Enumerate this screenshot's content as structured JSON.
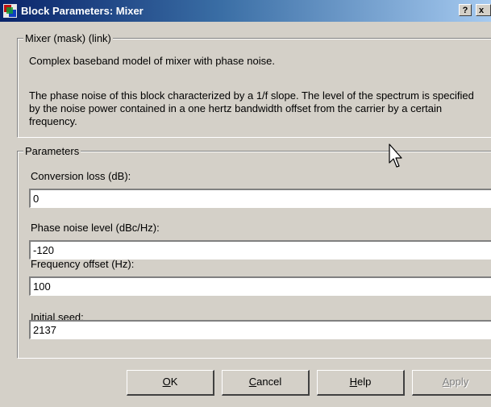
{
  "window": {
    "title": "Block Parameters: Mixer",
    "help_glyph": "?",
    "close_glyph": "x"
  },
  "mask": {
    "legend": "Mixer (mask) (link)",
    "summary": "Complex baseband model of mixer with phase noise.",
    "description": "The phase noise of this block characterized by a 1/f slope.  The level of the spectrum is specified by the noise power contained in a one hertz bandwidth offset from the carrier by a certain frequency."
  },
  "parameters": {
    "legend": "Parameters",
    "fields": [
      {
        "label": "Conversion loss (dB):",
        "value": "0"
      },
      {
        "label": "Phase noise level (dBc/Hz):",
        "value": "-120"
      },
      {
        "label": "Frequency offset (Hz):",
        "value": "100"
      },
      {
        "label": "Initial seed:",
        "value": "2137"
      }
    ]
  },
  "buttons": {
    "ok": {
      "mnemonic": "O",
      "rest": "K"
    },
    "cancel": {
      "mnemonic": "C",
      "rest": "ancel"
    },
    "help": {
      "mnemonic": "H",
      "rest": "elp"
    },
    "apply": {
      "mnemonic": "A",
      "rest": "pply"
    }
  },
  "colors": {
    "title_start": "#0a246a",
    "title_end": "#a6caf0",
    "face": "#d4d0c8"
  }
}
